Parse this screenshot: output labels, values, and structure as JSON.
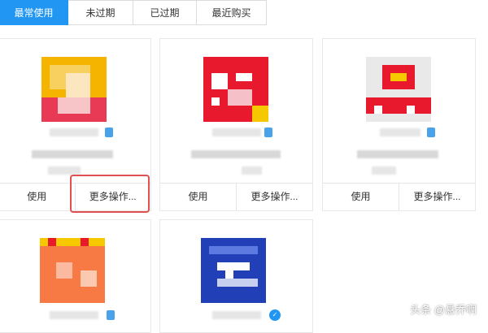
{
  "tabs": [
    {
      "label": "最常使用",
      "active": true
    },
    {
      "label": "未过期",
      "active": false
    },
    {
      "label": "已过期",
      "active": false
    },
    {
      "label": "最近购买",
      "active": false
    }
  ],
  "cards": [
    {
      "use_label": "使用",
      "more_label": "更多操作..."
    },
    {
      "use_label": "使用",
      "more_label": "更多操作..."
    },
    {
      "use_label": "使用",
      "more_label": "更多操作..."
    }
  ],
  "watermark": "头条 @悬乔啊",
  "colors": {
    "accent": "#2196f3",
    "highlight": "#e05050"
  }
}
